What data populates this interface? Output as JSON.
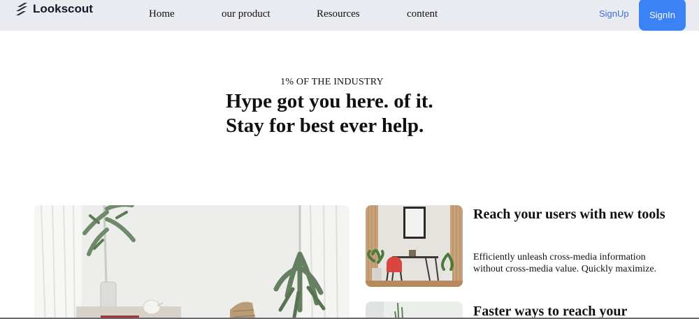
{
  "header": {
    "logo_text": "Lookscout",
    "logo_icon": "stacked-bars-logo-icon",
    "nav": [
      {
        "label": "Home"
      },
      {
        "label": "our product"
      },
      {
        "label": "Resources"
      },
      {
        "label": "content"
      }
    ],
    "signup_label": "SignUp",
    "signin_label": "SignIn"
  },
  "hero": {
    "eyebrow": "1% OF THE INDUSTRY",
    "title_line1": "Hype got you here. of it.",
    "title_line2": "Stay for best ever help."
  },
  "features": [
    {
      "title": "Reach your users with new tools",
      "text": "Efficiently unleash cross-media information without cross-media value. Quickly maximize."
    },
    {
      "title": "Faster ways to reach your"
    }
  ],
  "colors": {
    "nav_bg": "#e9ebf0",
    "accent": "#3b82f6",
    "link": "#3b6fd8"
  }
}
